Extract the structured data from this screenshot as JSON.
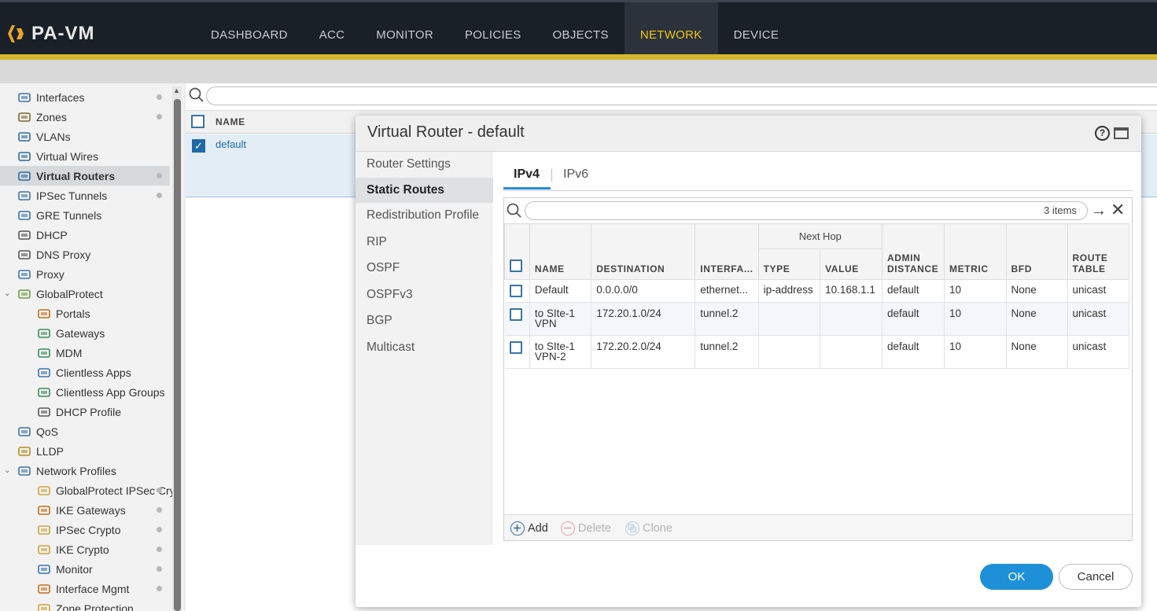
{
  "app": {
    "logo_text": "PA-VM",
    "accent_color": "#d4b72c",
    "active_nav_color": "#f0c51a"
  },
  "nav": [
    "DASHBOARD",
    "ACC",
    "MONITOR",
    "POLICIES",
    "OBJECTS",
    "NETWORK",
    "DEVICE"
  ],
  "nav_active": "NETWORK",
  "sidebar": {
    "items": [
      {
        "label": "Interfaces",
        "icon": "interfaces-icon",
        "dot": true
      },
      {
        "label": "Zones",
        "icon": "zones-icon",
        "dot": true
      },
      {
        "label": "VLANs",
        "icon": "vlans-icon",
        "dot": false
      },
      {
        "label": "Virtual Wires",
        "icon": "virtual-wires-icon",
        "dot": false
      },
      {
        "label": "Virtual Routers",
        "icon": "virtual-routers-icon",
        "dot": true,
        "active": true
      },
      {
        "label": "IPSec Tunnels",
        "icon": "ipsec-tunnels-icon",
        "dot": true
      },
      {
        "label": "GRE Tunnels",
        "icon": "gre-tunnels-icon",
        "dot": false
      },
      {
        "label": "DHCP",
        "icon": "dhcp-icon",
        "dot": false
      },
      {
        "label": "DNS Proxy",
        "icon": "dns-proxy-icon",
        "dot": false
      },
      {
        "label": "Proxy",
        "icon": "proxy-icon",
        "dot": false
      },
      {
        "label": "GlobalProtect",
        "icon": "globalprotect-icon",
        "dot": false,
        "caret": true
      },
      {
        "label": "Portals",
        "icon": "portals-icon",
        "dot": false,
        "indent": true
      },
      {
        "label": "Gateways",
        "icon": "gateways-icon",
        "dot": false,
        "indent": true
      },
      {
        "label": "MDM",
        "icon": "mdm-icon",
        "dot": false,
        "indent": true
      },
      {
        "label": "Clientless Apps",
        "icon": "clientless-apps-icon",
        "dot": false,
        "indent": true
      },
      {
        "label": "Clientless App Groups",
        "icon": "clientless-app-groups-icon",
        "dot": false,
        "indent": true
      },
      {
        "label": "DHCP Profile",
        "icon": "dhcp-profile-icon",
        "dot": false,
        "indent": true
      },
      {
        "label": "QoS",
        "icon": "qos-icon",
        "dot": false
      },
      {
        "label": "LLDP",
        "icon": "lldp-icon",
        "dot": false
      },
      {
        "label": "Network Profiles",
        "icon": "network-profiles-icon",
        "dot": false,
        "caret": true
      },
      {
        "label": "GlobalProtect IPSec Cry",
        "icon": "lock-icon",
        "dot": true,
        "indent": true
      },
      {
        "label": "IKE Gateways",
        "icon": "ike-gateways-icon",
        "dot": true,
        "indent": true
      },
      {
        "label": "IPSec Crypto",
        "icon": "lock-icon",
        "dot": true,
        "indent": true
      },
      {
        "label": "IKE Crypto",
        "icon": "lock-icon",
        "dot": true,
        "indent": true
      },
      {
        "label": "Monitor",
        "icon": "monitor-icon",
        "dot": true,
        "indent": true
      },
      {
        "label": "Interface Mgmt",
        "icon": "interface-mgmt-icon",
        "dot": true,
        "indent": true
      },
      {
        "label": "Zone Protection",
        "icon": "zone-protection-icon",
        "dot": false,
        "indent": true
      }
    ]
  },
  "background_table": {
    "header_name": "NAME",
    "row_name": "default"
  },
  "modal": {
    "title": "Virtual Router - default",
    "help_symbol": "?",
    "menu": [
      "Router Settings",
      "Static Routes",
      "Redistribution Profile",
      "RIP",
      "OSPF",
      "OSPFv3",
      "BGP",
      "Multicast"
    ],
    "menu_active": "Static Routes",
    "tabs": [
      "IPv4",
      "IPv6"
    ],
    "tab_active": "IPv4",
    "items_count": "3 items",
    "columns": {
      "name": "NAME",
      "destination": "DESTINATION",
      "interface": "INTERFA...",
      "next_hop_group": "Next Hop",
      "type": "TYPE",
      "value": "VALUE",
      "admin_distance_1": "ADMIN",
      "admin_distance_2": "DISTANCE",
      "metric": "METRIC",
      "bfd": "BFD",
      "route_table_1": "ROUTE",
      "route_table_2": "TABLE"
    },
    "rows": [
      {
        "name": "Default",
        "destination": "0.0.0.0/0",
        "interface": "ethernet...",
        "type": "ip-address",
        "value": "10.168.1.1",
        "admin_distance": "default",
        "metric": "10",
        "bfd": "None",
        "route_table": "unicast"
      },
      {
        "name": "to SIte-1 VPN",
        "destination": "172.20.1.0/24",
        "interface": "tunnel.2",
        "type": "",
        "value": "",
        "admin_distance": "default",
        "metric": "10",
        "bfd": "None",
        "route_table": "unicast"
      },
      {
        "name": "to SIte-1 VPN-2",
        "destination": "172.20.2.0/24",
        "interface": "tunnel.2",
        "type": "",
        "value": "",
        "admin_distance": "default",
        "metric": "10",
        "bfd": "None",
        "route_table": "unicast"
      }
    ],
    "footer": {
      "add": "Add",
      "delete": "Delete",
      "clone": "Clone"
    },
    "ok": "OK",
    "cancel": "Cancel",
    "ok_color": "#1e90d8"
  }
}
